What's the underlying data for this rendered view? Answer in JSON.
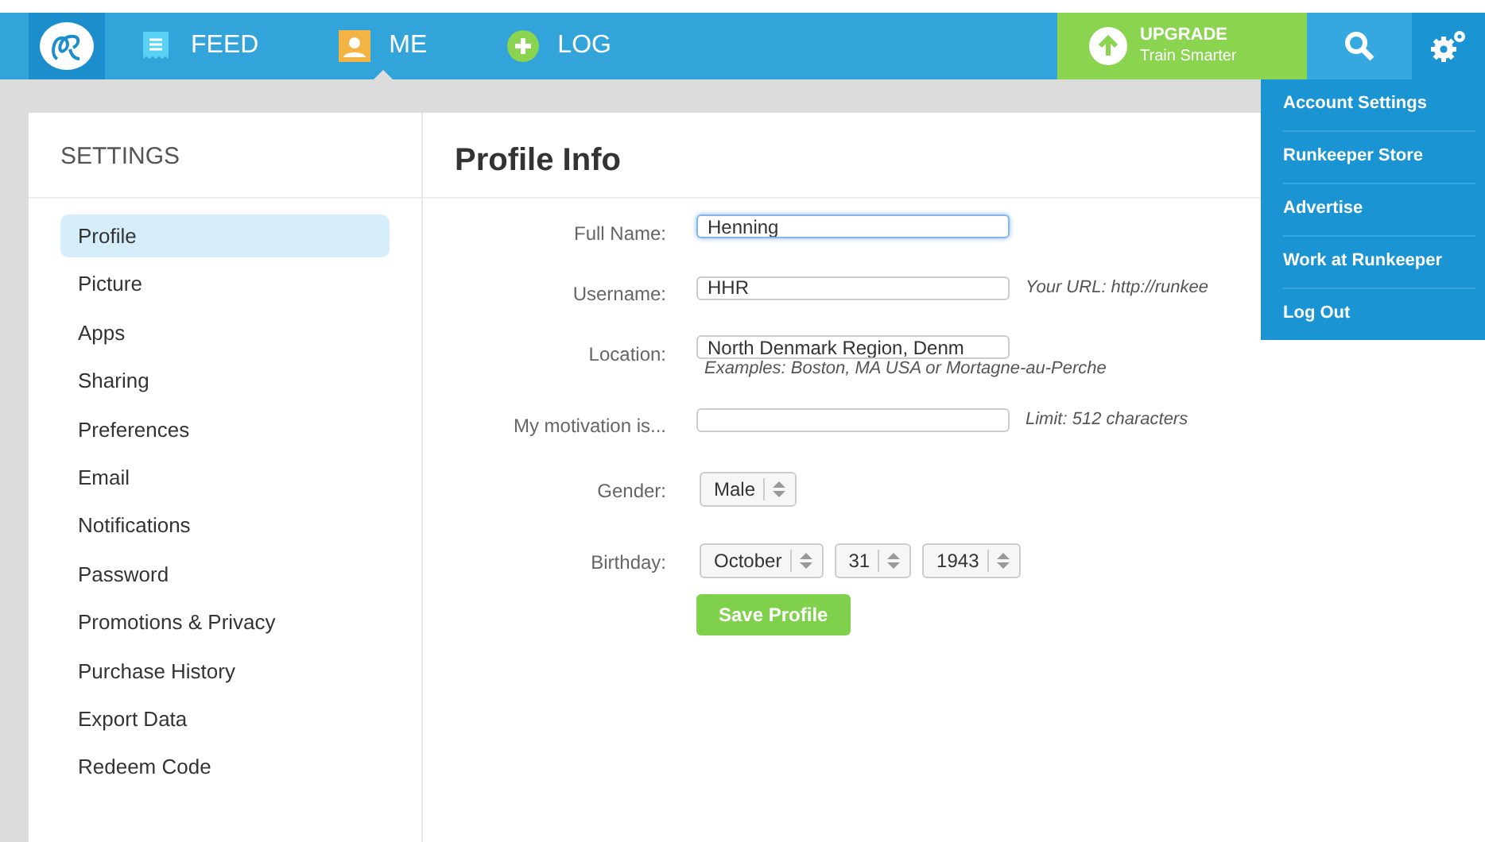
{
  "nav": {
    "items": [
      {
        "label": "FEED",
        "kind": "feed",
        "selected": false
      },
      {
        "label": "ME",
        "kind": "me",
        "selected": true
      },
      {
        "label": "LOG",
        "kind": "log",
        "selected": false
      }
    ],
    "upgrade": {
      "title": "UPGRADE",
      "subtitle": "Train Smarter"
    }
  },
  "menu": {
    "items": [
      "Account Settings",
      "Runkeeper Store",
      "Advertise",
      "Work at Runkeeper",
      "Log Out"
    ]
  },
  "sidebar": {
    "title": "SETTINGS",
    "items": [
      {
        "label": "Profile",
        "selected": true
      },
      {
        "label": "Picture",
        "selected": false
      },
      {
        "label": "Apps",
        "selected": false
      },
      {
        "label": "Sharing",
        "selected": false
      },
      {
        "label": "Preferences",
        "selected": false
      },
      {
        "label": "Email",
        "selected": false
      },
      {
        "label": "Notifications",
        "selected": false
      },
      {
        "label": "Password",
        "selected": false
      },
      {
        "label": "Promotions & Privacy",
        "selected": false
      },
      {
        "label": "Purchase History",
        "selected": false
      },
      {
        "label": "Export Data",
        "selected": false
      },
      {
        "label": "Redeem Code",
        "selected": false
      }
    ]
  },
  "form": {
    "title": "Profile Info",
    "fields": [
      {
        "label": "Full Name:",
        "kind": "text",
        "value": "Henning",
        "focused": true
      },
      {
        "label": "Username:",
        "kind": "text",
        "value": "HHR",
        "focused": false,
        "note": "Your URL: http://runkee"
      },
      {
        "label": "Location:",
        "kind": "text",
        "value": "North Denmark Region, Denm",
        "focused": false,
        "hint": "Examples: Boston, MA USA or Mortagne-au-Perche"
      },
      {
        "label": "My motivation is...",
        "kind": "text",
        "focused": false,
        "note": "Limit: 512 characters"
      },
      {
        "label": "Gender:",
        "kind": "select",
        "selects": [
          "Male"
        ]
      },
      {
        "label": "Birthday:",
        "kind": "select",
        "selects": [
          "October",
          "31",
          "1943"
        ]
      }
    ],
    "button": "Save Profile"
  }
}
